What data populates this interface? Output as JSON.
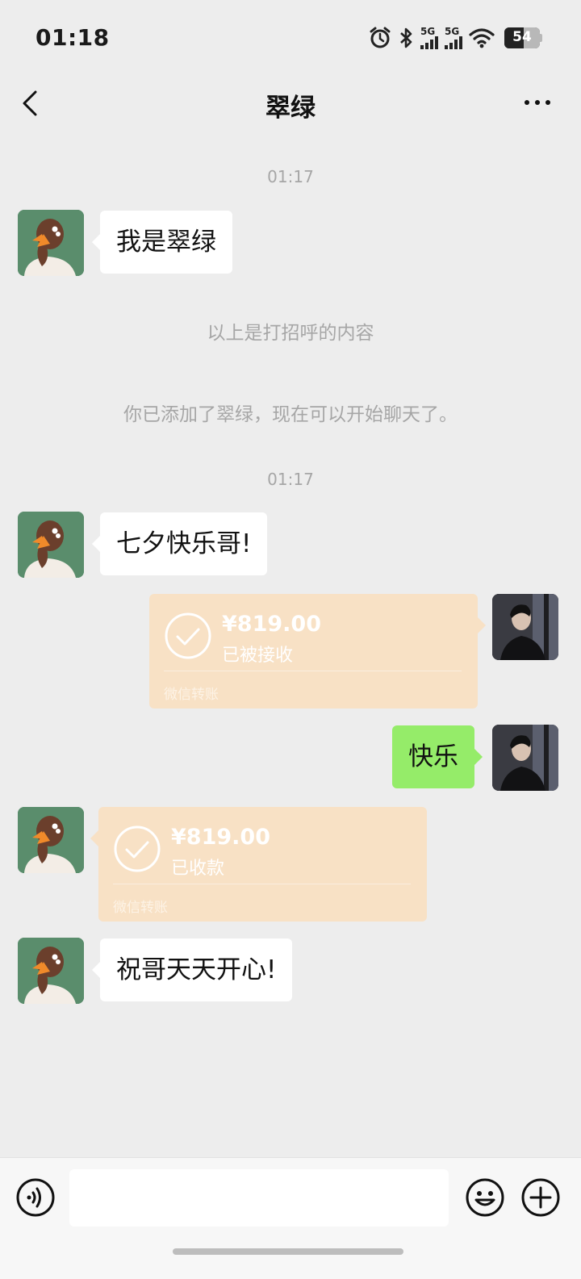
{
  "status": {
    "time": "01:18",
    "net1": "5G",
    "net2": "5G",
    "battery": "54",
    "battery_level": 0.54
  },
  "header": {
    "title": "翠绿"
  },
  "messages": {
    "m1": {
      "time": "01:17",
      "text": "我是翠绿"
    },
    "sys1": "以上是打招呼的内容",
    "sys2": "你已添加了翠绿，现在可以开始聊天了。",
    "m2": {
      "time": "01:17",
      "text": "七夕快乐哥!"
    },
    "t1": {
      "amount": "¥819.00",
      "status": "已被接收",
      "source": "微信转账"
    },
    "m3": {
      "text": "快乐"
    },
    "t2": {
      "amount": "¥819.00",
      "status": "已收款",
      "source": "微信转账"
    },
    "m4": {
      "text": "祝哥天天开心!"
    }
  },
  "colors": {
    "bg": "#ededed",
    "sent_bubble": "#95ec69",
    "transfer_bubble": "#f8e1c5"
  },
  "icons": [
    "alarm-icon",
    "bluetooth-icon",
    "signal-icon",
    "wifi-icon",
    "battery-icon",
    "back-icon",
    "more-icon",
    "voice-icon",
    "emoji-icon",
    "plus-icon",
    "check-icon"
  ]
}
